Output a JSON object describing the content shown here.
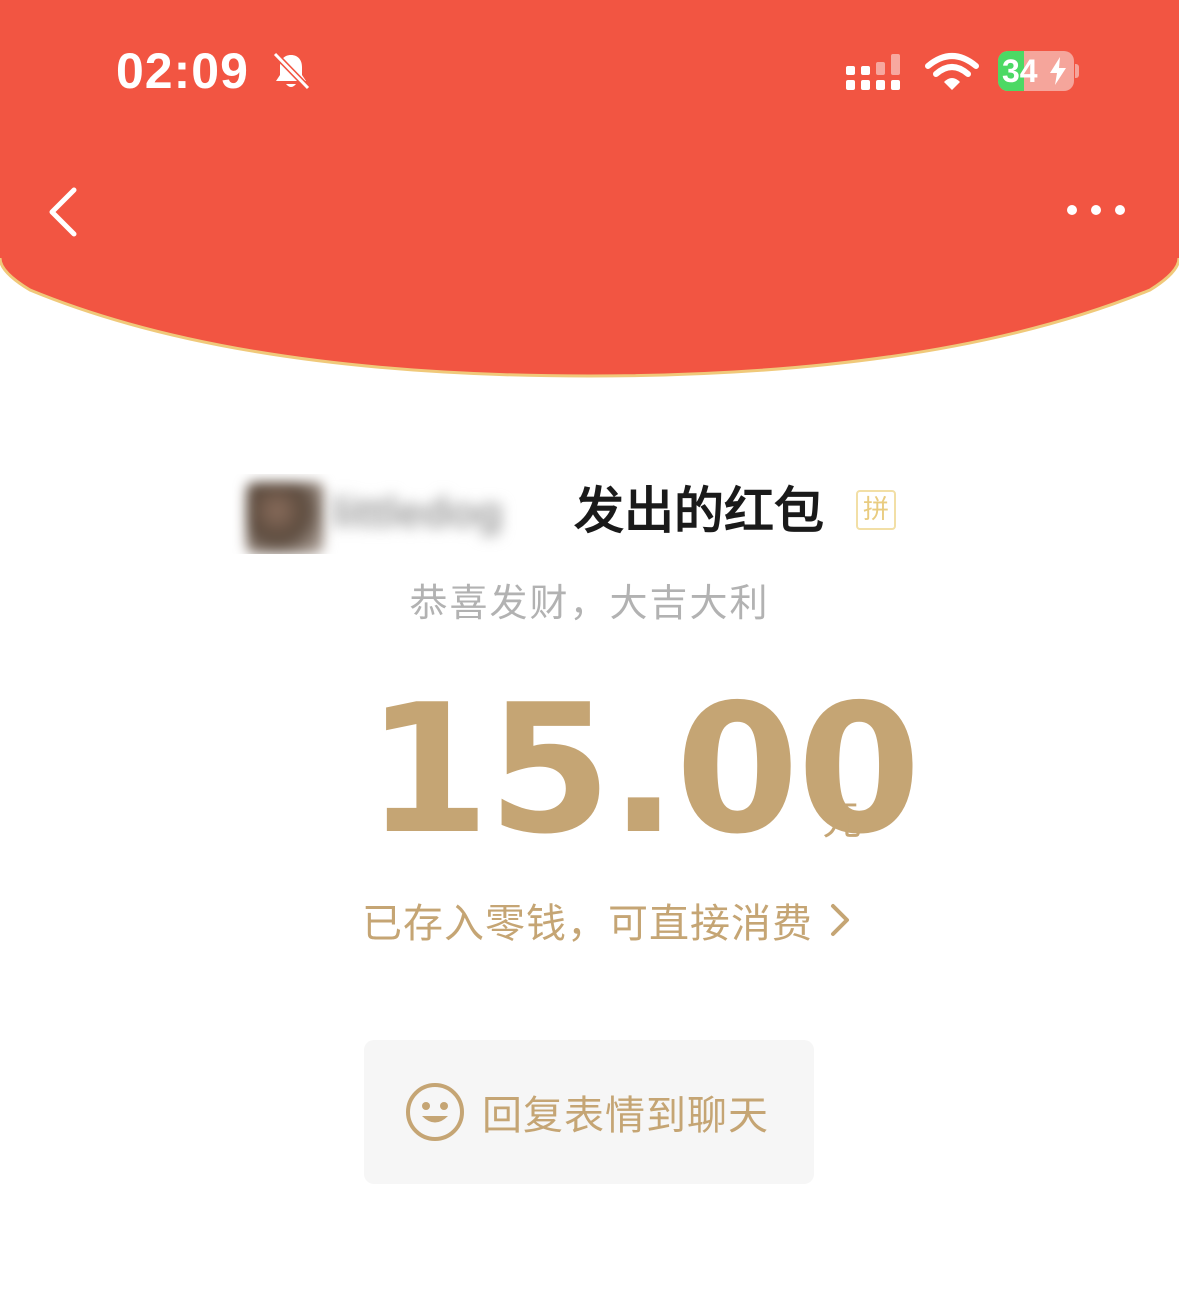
{
  "colors": {
    "header_red": "#f25542",
    "header_border": "#f0c97a",
    "gold": "#c5a574",
    "greeting_gray": "#b2b2b2",
    "title_black": "#1a1a1a",
    "button_bg": "#f6f6f6"
  },
  "status_bar": {
    "time": "02:09",
    "mute_icon": "bell-slash-icon",
    "signal_icon": "cellular-signal-icon",
    "wifi_icon": "wifi-icon",
    "battery_percent": "34",
    "battery_level": 0.34,
    "charging": true
  },
  "nav": {
    "back_icon": "chevron-left-icon",
    "more_icon": "more-dots-icon"
  },
  "envelope": {
    "sender_name_redacted": "littledog",
    "title_suffix": "发出的红包",
    "pin_badge": "拼",
    "greeting": "恭喜发财，大吉大利",
    "amount": "15.00",
    "currency_unit": "元",
    "wallet_note": "已存入零钱，可直接消费",
    "reply_button_label": "回复表情到聊天"
  }
}
